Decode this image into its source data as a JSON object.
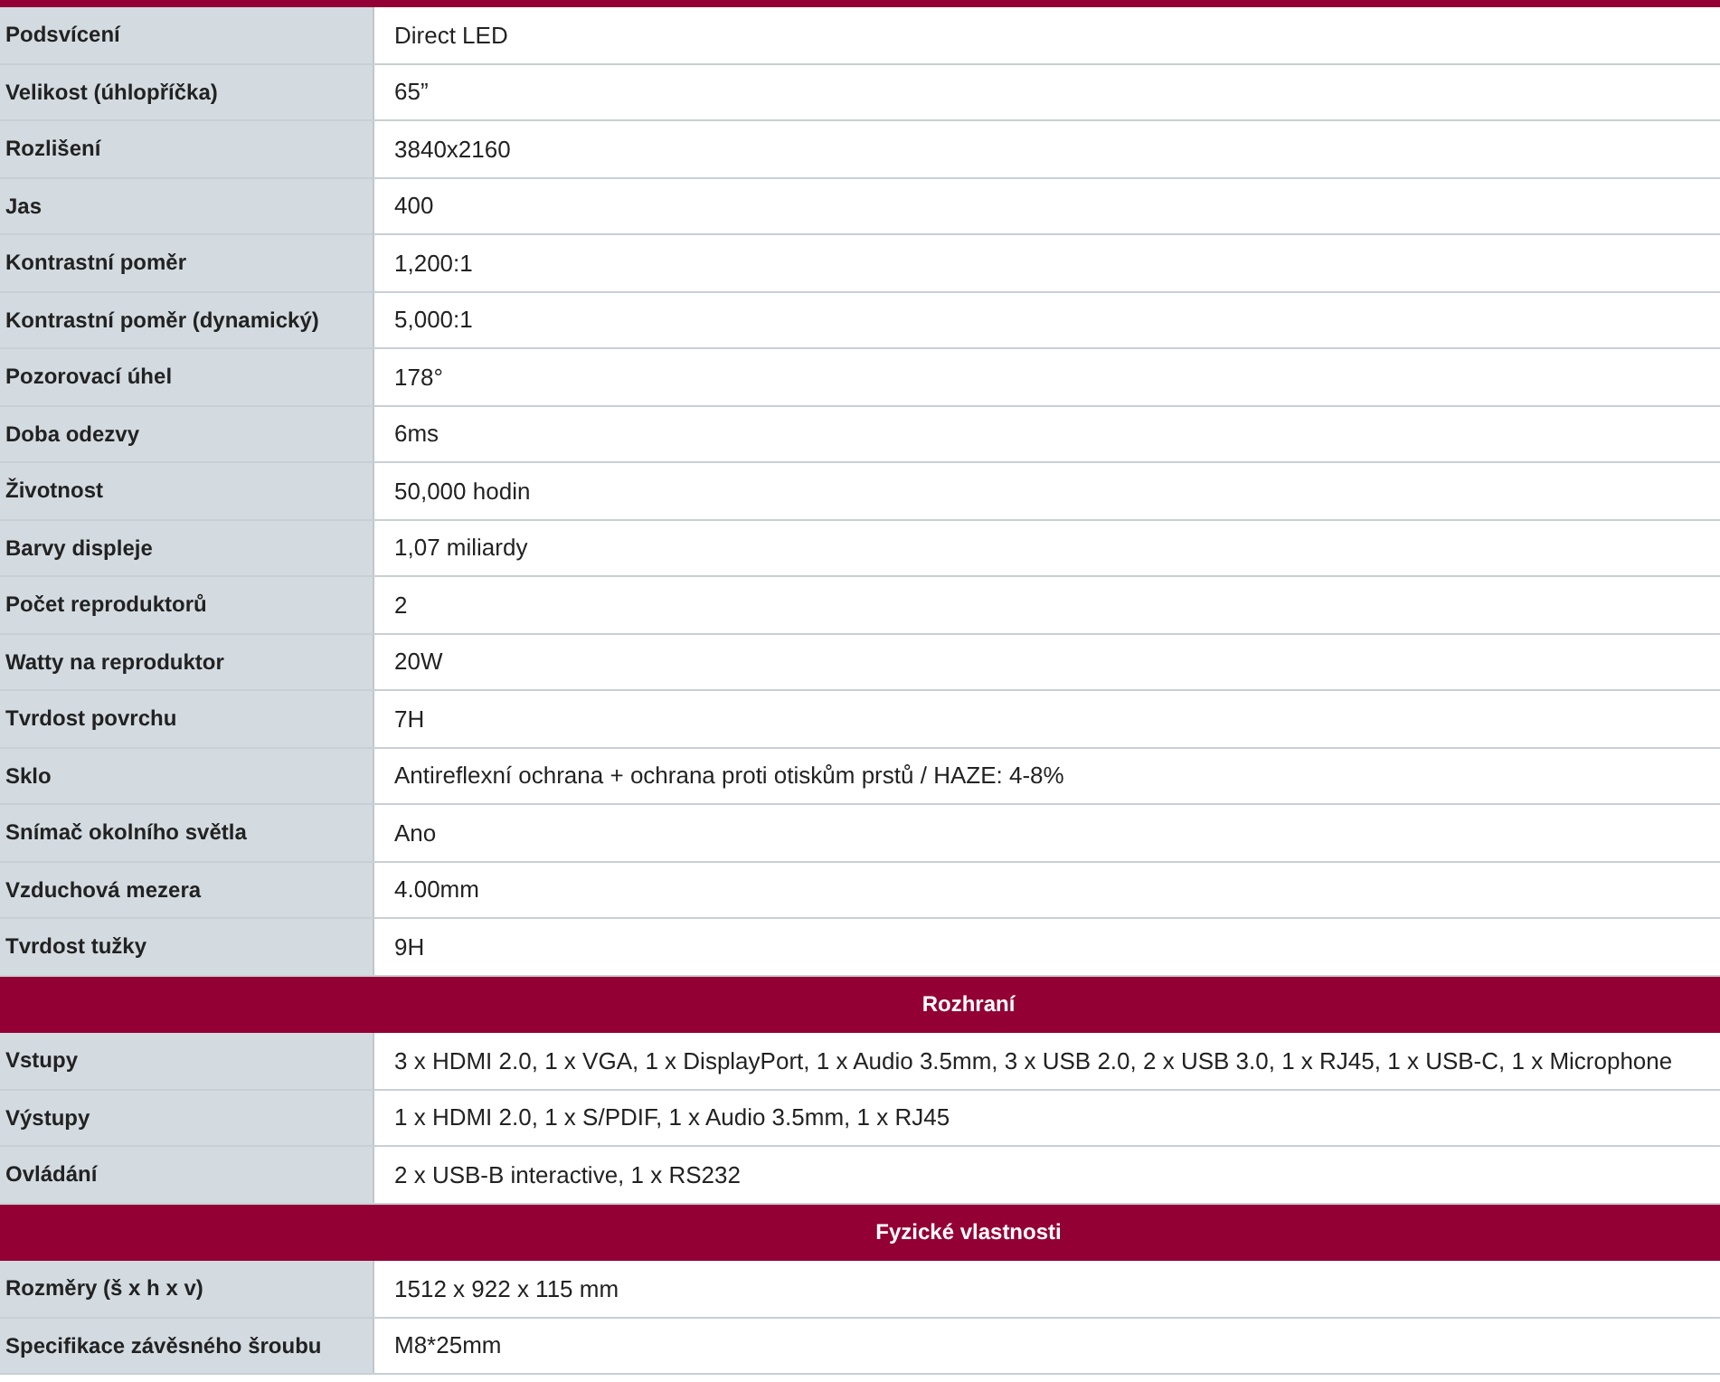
{
  "rows": [
    {
      "kind": "spec",
      "label": "Podsvícení",
      "value": "Direct LED"
    },
    {
      "kind": "spec",
      "label": "Velikost (úhlopříčka)",
      "value": "65”"
    },
    {
      "kind": "spec",
      "label": "Rozlišení",
      "value": "3840x2160"
    },
    {
      "kind": "spec",
      "label": "Jas",
      "value": "400"
    },
    {
      "kind": "spec",
      "label": "Kontrastní poměr",
      "value": "1,200:1"
    },
    {
      "kind": "spec",
      "label": "Kontrastní poměr (dynamický)",
      "value": "5,000:1"
    },
    {
      "kind": "spec",
      "label": "Pozorovací úhel",
      "value": "178°"
    },
    {
      "kind": "spec",
      "label": "Doba odezvy",
      "value": "6ms"
    },
    {
      "kind": "spec",
      "label": "Životnost",
      "value": "50,000 hodin"
    },
    {
      "kind": "spec",
      "label": "Barvy displeje",
      "value": "1,07 miliardy"
    },
    {
      "kind": "spec",
      "label": "Počet reproduktorů",
      "value": "2"
    },
    {
      "kind": "spec",
      "label": "Watty na reproduktor",
      "value": "20W"
    },
    {
      "kind": "spec",
      "label": "Tvrdost povrchu",
      "value": "7H"
    },
    {
      "kind": "spec",
      "label": "Sklo",
      "value": "Antireflexní ochrana + ochrana proti otiskům prstů / HAZE: 4-8%"
    },
    {
      "kind": "spec",
      "label": "Snímač okolního světla",
      "value": "Ano"
    },
    {
      "kind": "spec",
      "label": "Vzduchová mezera",
      "value": "4.00mm"
    },
    {
      "kind": "spec",
      "label": "Tvrdost tužky",
      "value": "9H"
    },
    {
      "kind": "section",
      "label": "Rozhraní"
    },
    {
      "kind": "spec",
      "label": "Vstupy",
      "value": "3 x HDMI 2.0, 1 x VGA, 1 x DisplayPort, 1 x Audio 3.5mm, 3 x USB 2.0, 2 x USB 3.0, 1 x RJ45, 1 x USB-C, 1 x Microphone"
    },
    {
      "kind": "spec",
      "label": "Výstupy",
      "value": "1 x HDMI 2.0, 1 x S/PDIF, 1 x Audio 3.5mm, 1 x RJ45"
    },
    {
      "kind": "spec",
      "label": "Ovládání",
      "value": "2 x USB-B interactive, 1 x RS232"
    },
    {
      "kind": "section",
      "label": "Fyzické vlastnosti"
    },
    {
      "kind": "spec",
      "label": "Rozměry (š x h x v)",
      "value": "1512 x 922 x 115 mm"
    },
    {
      "kind": "spec",
      "label": "Specifikace závěsného šroubu",
      "value": "M8*25mm"
    }
  ]
}
